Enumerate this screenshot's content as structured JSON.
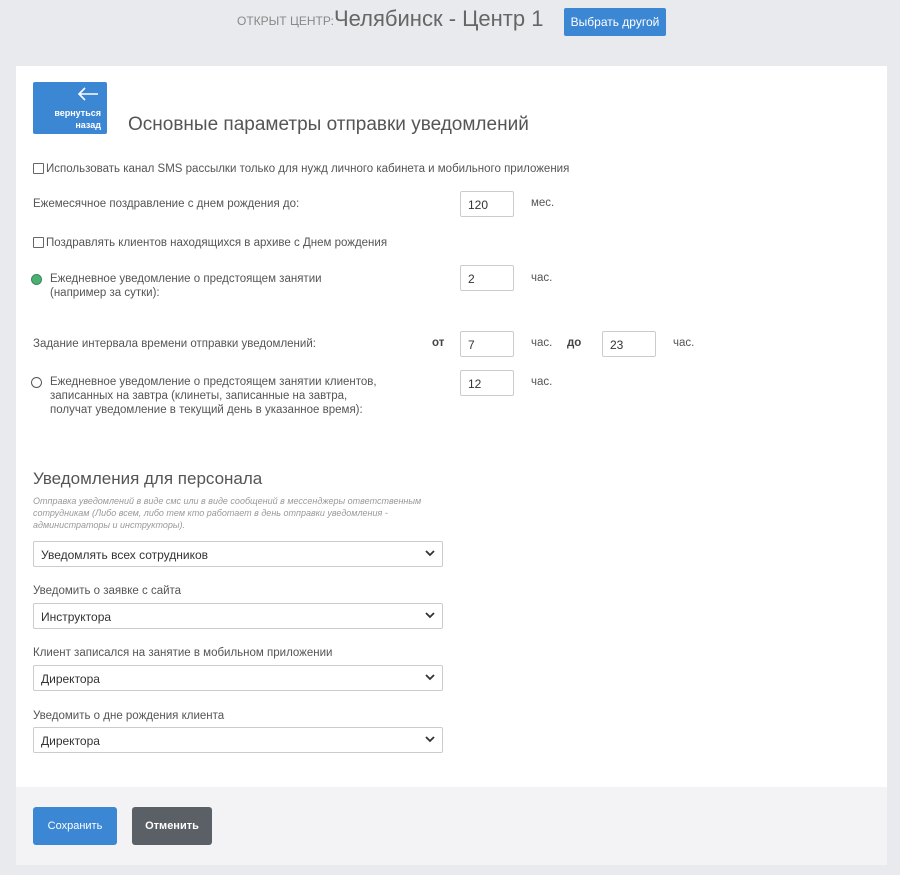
{
  "header": {
    "center_label": "ОТКРЫТ ЦЕНТР:",
    "center_name": "Челябинск - Центр 1",
    "choose_other": "Выбрать другой"
  },
  "back_button": {
    "label": "вернуться назад",
    "icon": "arrow-left-icon"
  },
  "page_title": "Основные параметры отправки уведомлений",
  "options": {
    "sms_only_label": "Использовать канал SMS рассылки только для нужд личного кабинета и мобильного приложения",
    "sms_only_checked": false,
    "birthday_monthly_label": "Ежемесячное поздравление с днем рождения до:",
    "birthday_monthly_value": "120",
    "birthday_monthly_unit": "мес.",
    "archive_birthday_label": "Поздравлять клиентов находящихся в архиве с Днем рождения",
    "archive_birthday_checked": false,
    "daily_reminder_label": "Ежедневное уведомление о предстоящем занятии (например за сутки):",
    "daily_reminder_value": "2",
    "daily_reminder_unit": "час.",
    "daily_reminder_selected": true,
    "interval_label": "Задание интервала времени отправки уведомлений:",
    "interval_from_label": "от",
    "interval_from_value": "7",
    "interval_from_unit": "час.",
    "interval_to_label": "до",
    "interval_to_value": "23",
    "interval_to_unit": "час.",
    "tomorrow_reminder_label": "Ежедневное уведомление о предстоящем занятии клиентов, записанных на завтра (клинеты, записанные на завтра, получат уведомление в текущий день в указанное время):",
    "tomorrow_reminder_value": "12",
    "tomorrow_reminder_unit": "час.",
    "tomorrow_reminder_selected": false
  },
  "staff": {
    "title": "Уведомления для персонала",
    "hint": "Отправка уведомлений в виде смс или в виде сообщений в мессенджеры ответственным сотрудникам (Либо всем, либо тем кто работает в день отправки уведомления - администраторы и инструкторы).",
    "who_select_value": "Уведомлять всех сотрудников",
    "site_request_label": "Уведомить о заявке с сайта",
    "site_request_value": "Инструктора",
    "mobile_booking_label": "Клиент записался на занятие в мобильном приложении",
    "mobile_booking_value": "Директора",
    "client_birthday_label": "Уведомить о дне рождения клиента",
    "client_birthday_value": "Директора"
  },
  "footer": {
    "save": "Сохранить",
    "cancel": "Отменить"
  },
  "colors": {
    "accent": "#3b87d4",
    "cancel": "#5b5f66",
    "radio_on": "#4caf73"
  }
}
